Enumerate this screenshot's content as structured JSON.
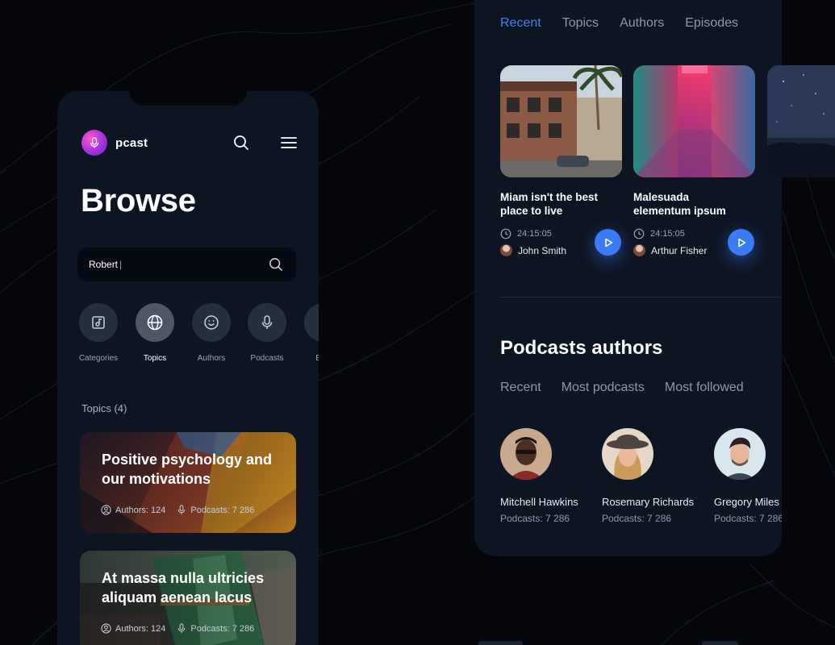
{
  "app": {
    "brand_name": "pcast",
    "page_title": "Browse"
  },
  "search": {
    "value": "Robert"
  },
  "categories": [
    {
      "label": "Categories",
      "icon": "music-album-icon",
      "active": false
    },
    {
      "label": "Topics",
      "icon": "globe-icon",
      "active": true
    },
    {
      "label": "Authors",
      "icon": "smile-icon",
      "active": false
    },
    {
      "label": "Podcasts",
      "icon": "microphone-icon",
      "active": false
    },
    {
      "label": "Epis",
      "icon": "episodes-icon",
      "active": false
    }
  ],
  "topics": {
    "heading": "Topics (4)",
    "cards": [
      {
        "title": "Positive psychology and our motivations",
        "authors": "Authors: 124",
        "podcasts": "Podcasts: 7 286"
      },
      {
        "title": "At massa nulla ultricies aliquam aenean lacus",
        "authors": "Authors: 124",
        "podcasts": "Podcasts: 7 286"
      }
    ]
  },
  "episode_tabs": [
    {
      "label": "Recent",
      "active": true
    },
    {
      "label": "Topics",
      "active": false
    },
    {
      "label": "Authors",
      "active": false
    },
    {
      "label": "Episodes",
      "active": false
    }
  ],
  "episodes": [
    {
      "title": "Miam isn't the best place to live",
      "duration": "24:15:05",
      "author": "John Smith"
    },
    {
      "title": "Malesuada elementum ipsum",
      "duration": "24:15:05",
      "author": "Arthur Fisher"
    }
  ],
  "authors_section": {
    "title": "Podcasts authors",
    "tabs": [
      "Recent",
      "Most podcasts",
      "Most followed"
    ],
    "authors": [
      {
        "name": "Mitchell Hawkins",
        "count": "Podcasts: 7 286"
      },
      {
        "name": "Rosemary Richards",
        "count": "Podcasts: 7 286"
      },
      {
        "name": "Gregory Miles",
        "count": "Podcasts: 7 286"
      }
    ]
  },
  "colors": {
    "background": "#05070c",
    "panel": "#0d1422",
    "accent": "#3b82f6",
    "muted_text": "#8f98a8"
  }
}
